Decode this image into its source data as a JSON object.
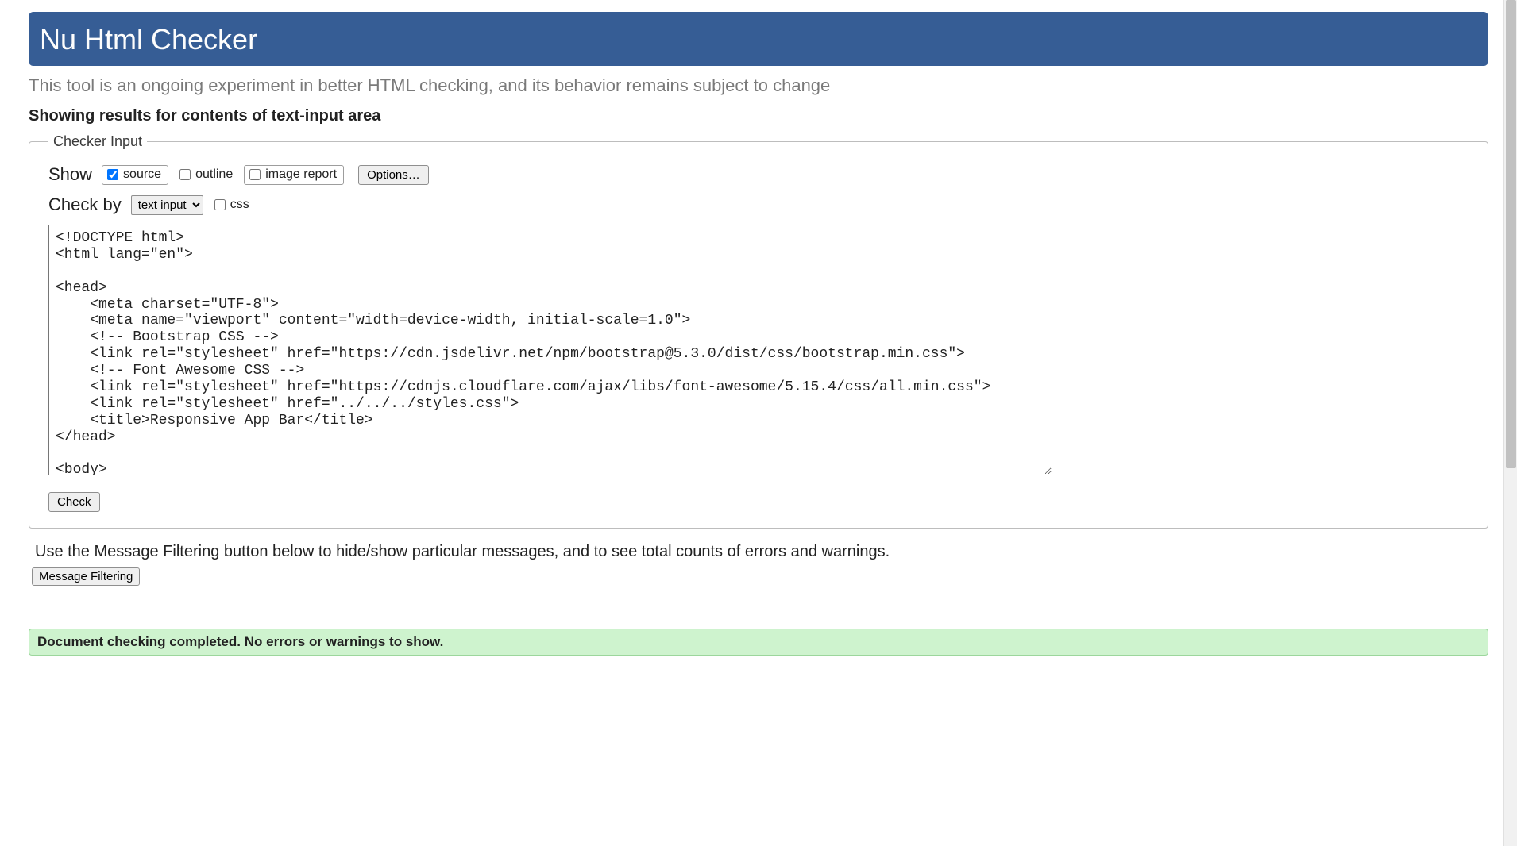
{
  "header": {
    "title": "Nu Html Checker",
    "tagline": "This tool is an ongoing experiment in better HTML checking, and its behavior remains subject to change",
    "showing": "Showing results for contents of text-input area"
  },
  "checker": {
    "legend": "Checker Input",
    "show_label": "Show",
    "source_label": "source",
    "source_checked": true,
    "outline_label": "outline",
    "outline_checked": false,
    "image_report_label": "image report",
    "image_report_checked": false,
    "options_label": "Options…",
    "check_by_label": "Check by",
    "check_by_selected": "text input",
    "css_label": "css",
    "css_checked": false,
    "textarea_value": "<!DOCTYPE html>\n<html lang=\"en\">\n\n<head>\n    <meta charset=\"UTF-8\">\n    <meta name=\"viewport\" content=\"width=device-width, initial-scale=1.0\">\n    <!-- Bootstrap CSS -->\n    <link rel=\"stylesheet\" href=\"https://cdn.jsdelivr.net/npm/bootstrap@5.3.0/dist/css/bootstrap.min.css\">\n    <!-- Font Awesome CSS -->\n    <link rel=\"stylesheet\" href=\"https://cdnjs.cloudflare.com/ajax/libs/font-awesome/5.15.4/css/all.min.css\">\n    <link rel=\"stylesheet\" href=\"../../../styles.css\">\n    <title>Responsive App Bar</title>\n</head>\n\n<body>",
    "check_button": "Check"
  },
  "filter": {
    "explain": "Use the Message Filtering button below to hide/show particular messages, and to see total counts of errors and warnings.",
    "button": "Message Filtering"
  },
  "result": {
    "prefix": "Document checking completed. ",
    "status": "No errors or warnings to show."
  }
}
